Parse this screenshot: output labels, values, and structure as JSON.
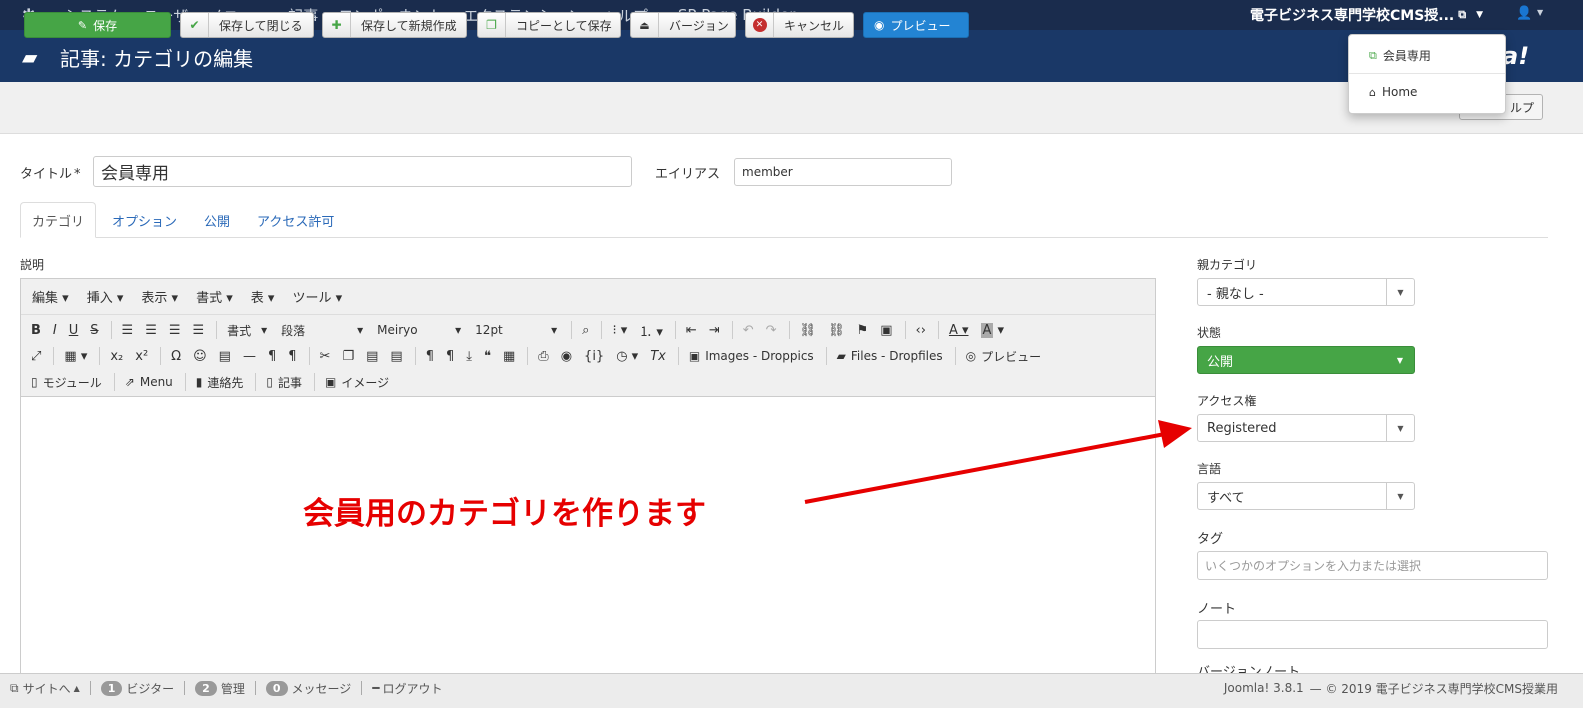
{
  "navbar": {
    "logo_glyph": "✱",
    "menu": [
      "システム",
      "ユーザ",
      "メニュー",
      "記事",
      "コンポーネント",
      "エクステンション",
      "ヘルプ",
      "SP Page Builder"
    ],
    "site_name": "電子ビジネス専門学校CMS授...",
    "user_glyph": "👤"
  },
  "header": {
    "title": "記事: カテゴリの編集",
    "brand": "a!"
  },
  "toolbar": {
    "save": "保存",
    "save_close": "保存して閉じる",
    "save_new": "保存して新規作成",
    "save_copy": "コピーとして保存",
    "versions": "バージョン",
    "cancel": "キャンセル",
    "preview": "プレビュー",
    "help": "ルプ"
  },
  "dropdown": {
    "items": [
      "会員専用",
      "Home"
    ]
  },
  "form": {
    "title_label": "タイトル",
    "required_mark": "*",
    "title_value": "会員専用",
    "alias_label": "エイリアス",
    "alias_value": "member"
  },
  "tabs": [
    "カテゴリ",
    "オプション",
    "公開",
    "アクセス許可"
  ],
  "editor": {
    "description_label": "説明",
    "menus": [
      "編集",
      "挿入",
      "表示",
      "書式",
      "表",
      "ツール"
    ],
    "format_select": "書式",
    "block_select": "段落",
    "font_select": "Meiryo",
    "size_select": "12pt",
    "row2_text": [
      "Images - Droppics",
      "Files - Dropfiles",
      "プレビュー"
    ],
    "row3_text": [
      "モジュール",
      "Menu",
      "連絡先",
      "記事",
      "イメージ"
    ]
  },
  "sidebar": {
    "parent_label": "親カテゴリ",
    "parent_value": "- 親なし -",
    "status_label": "状態",
    "status_value": "公開",
    "access_label": "アクセス権",
    "access_value": "Registered",
    "language_label": "言語",
    "language_value": "すべて",
    "tags_label": "タグ",
    "tags_placeholder": "いくつかのオプションを入力または選択",
    "note_label": "ノート",
    "cut_label": "バージョンノート"
  },
  "annotation": {
    "text": "会員用のカテゴリを作ります",
    "color": "#e60000"
  },
  "statusbar": {
    "site": "サイトへ",
    "visitors_count": "1",
    "visitors": "ビジター",
    "admins_count": "2",
    "admins": "管理",
    "messages_count": "0",
    "messages": "メッセージ",
    "logout": "ログアウト",
    "version": "Joomla! 3.8.1",
    "copyright": "— © 2019 電子ビジネス専門学校CMS授業用"
  },
  "colors": {
    "navbar": "#1a2c4d",
    "header": "#1a3867",
    "save_green": "#46a546",
    "preview_blue": "#2384d3",
    "link_blue": "#2a69b8"
  }
}
